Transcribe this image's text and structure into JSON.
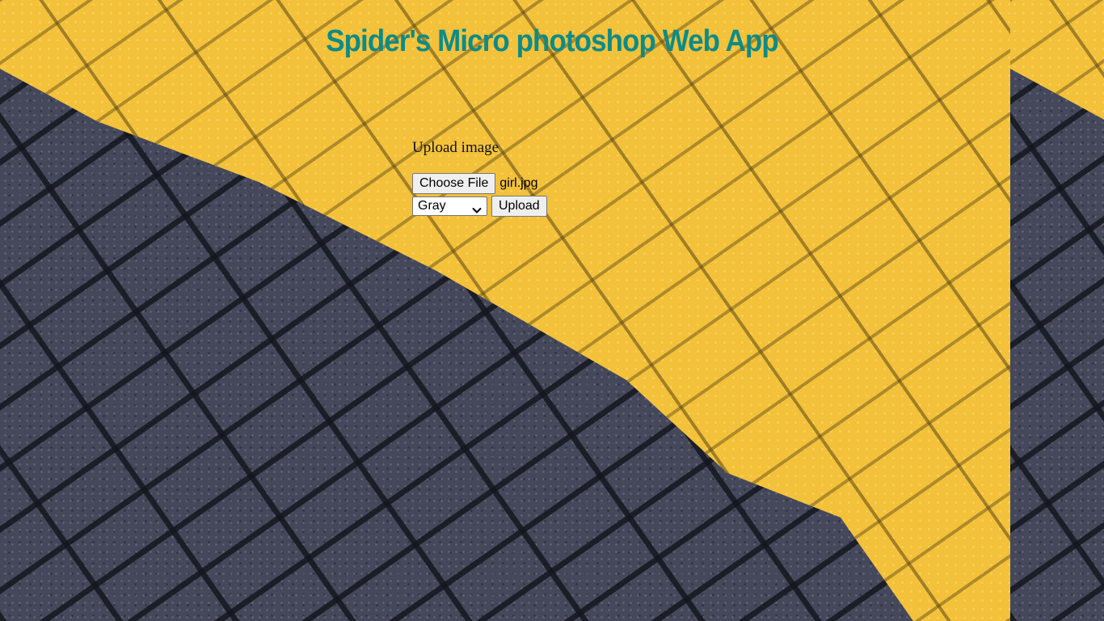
{
  "header": {
    "title": "Spider's Micro photoshop Web App"
  },
  "form": {
    "upload_label": "Upload image",
    "choose_file_label": "Choose File",
    "file_name": "girl.jpg",
    "filter_selected": "Gray",
    "upload_button_label": "Upload"
  },
  "icons": {
    "select_arrow": "chevron-down-icon"
  },
  "colors": {
    "title": "#0d8b87",
    "background_yellow": "#f3c13a",
    "background_dark": "#44485a"
  }
}
